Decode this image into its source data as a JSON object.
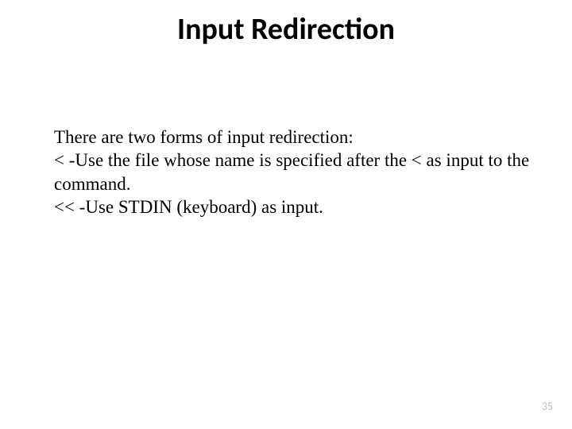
{
  "title": "Input Redirection",
  "body": {
    "line1": "There are two forms of input redirection:",
    "line2": " <   -Use the file whose name is specified after the < as input to the command.",
    "line3": " << -Use STDIN (keyboard) as input."
  },
  "page_number": "35"
}
